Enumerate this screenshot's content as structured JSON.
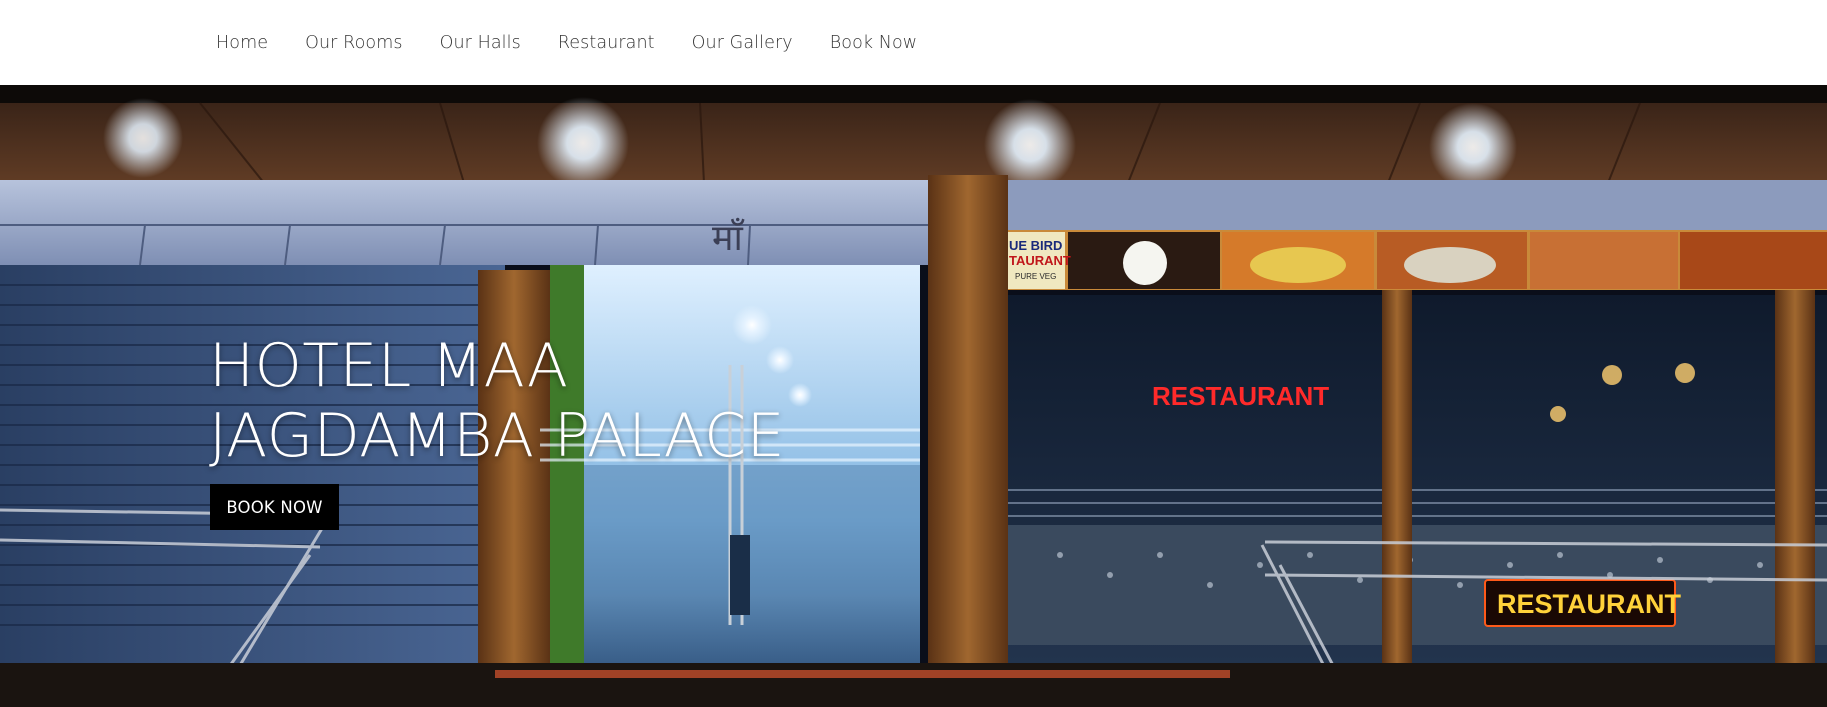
{
  "nav": {
    "items": [
      {
        "label": "Home"
      },
      {
        "label": "Our Rooms"
      },
      {
        "label": "Our Halls"
      },
      {
        "label": "Restaurant"
      },
      {
        "label": "Our Gallery"
      },
      {
        "label": "Book Now"
      }
    ]
  },
  "hero": {
    "title_line1": "HOTEL MAA",
    "title_line2": "JAGDAMBA PALACE",
    "cta_label": "BOOK NOW",
    "signs": {
      "restaurant_upper": "RESTAURANT",
      "restaurant_lower": "RESTAURANT",
      "banner_logo_line1": "UE BIRD",
      "banner_logo_line2": "TAURANT",
      "banner_logo_line3": "PURE VEG",
      "devanagari_mark": "माँ"
    }
  },
  "colors": {
    "nav_bg": "#ffffff",
    "nav_text": "#333333",
    "cta_bg": "#000000",
    "cta_text": "#ffffff",
    "neon_red": "#ff2a2a",
    "neon_yellow": "#ffd23a"
  }
}
